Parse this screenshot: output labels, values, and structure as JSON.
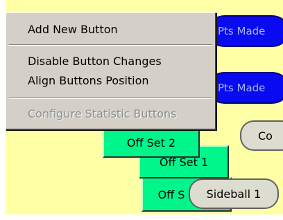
{
  "canvas": {
    "oval_buttons": [
      {
        "label": "Pts Made"
      },
      {
        "label": "Pts Made"
      }
    ],
    "gray_button_partial": {
      "label": "Co"
    },
    "green_buttons": [
      {
        "label": "Off Set 2"
      },
      {
        "label": "Off Set 1"
      },
      {
        "label": "Off S"
      }
    ],
    "sideball_button": {
      "label": "Sideball 1"
    }
  },
  "context_menu": {
    "items": [
      {
        "label": "Add New Button",
        "enabled": true
      },
      {
        "label": "Disable Button Changes",
        "enabled": true
      },
      {
        "label": "Align Buttons Position",
        "enabled": true
      },
      {
        "label": "Configure Statistic Buttons",
        "enabled": false
      }
    ]
  },
  "colors": {
    "canvas_background": "#ffffa6",
    "oval_fill": "#0a0af0",
    "green_fill": "#00f58a",
    "menu_background": "#d4d0c8"
  }
}
